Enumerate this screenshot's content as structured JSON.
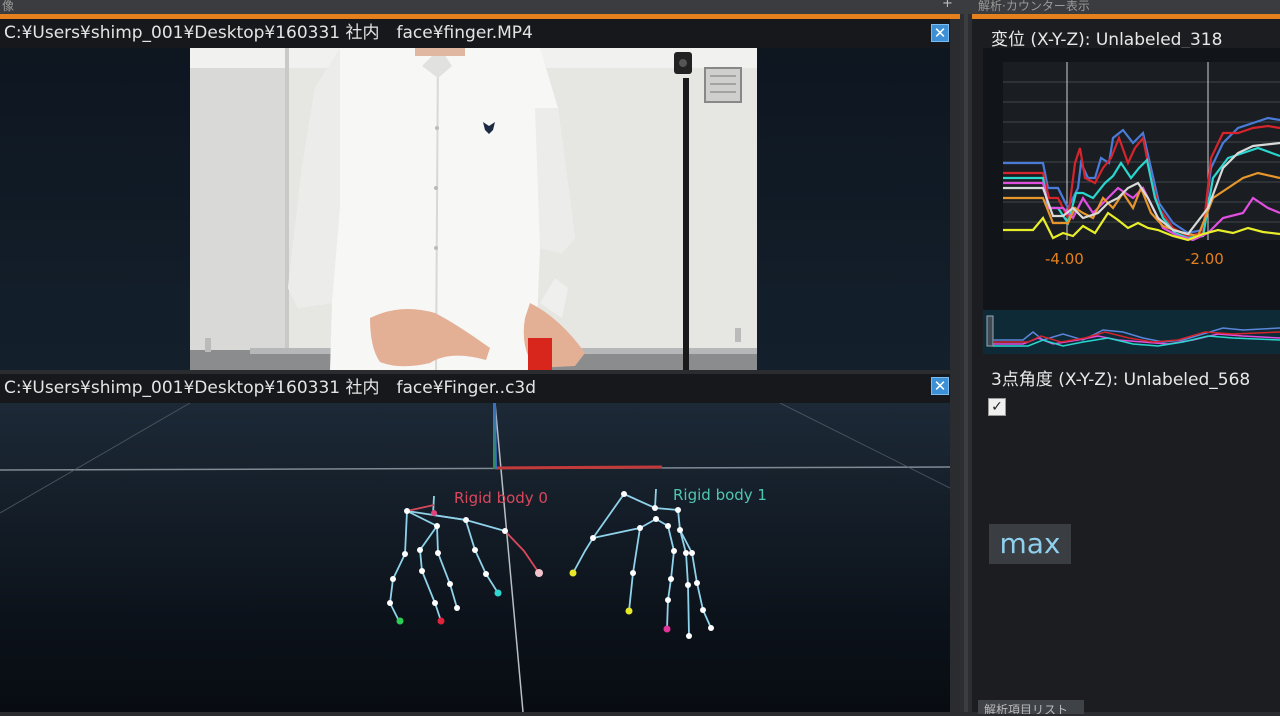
{
  "top_bar": {
    "left_fragment": "像",
    "right_fragment": "解析·カウンター表示",
    "plus": "+"
  },
  "video_panel": {
    "title": "C:¥Users¥shimp_001¥Desktop¥160331 社内　face¥finger.MP4",
    "close_glyph": "✕"
  },
  "viewport_panel": {
    "title": "C:¥Users¥shimp_001¥Desktop¥160331 社内　face¥Finger..c3d",
    "close_glyph": "✕",
    "rigid_body_0": "Rigid body 0",
    "rigid_body_1": "Rigid body 1"
  },
  "right_panel": {
    "graph_title": "変位 (X-Y-Z):  Unlabeled_318",
    "x_ticks": [
      "-4.00",
      "-2.00"
    ],
    "angle_title": "3点角度 (X-Y-Z):  Unlabeled_568",
    "checkbox_checked": true,
    "checkbox_glyph": "✓",
    "max_label": "max",
    "bottom_tab": "解析項目リスト"
  },
  "colors": {
    "accent": "#e5801e",
    "close_button": "#3d8fd6",
    "tick_label": "#e5801e",
    "rigid_body_0": "#d8485c",
    "rigid_body_1": "#4fc7b0",
    "skeleton_line": "#8fd2ea"
  }
}
